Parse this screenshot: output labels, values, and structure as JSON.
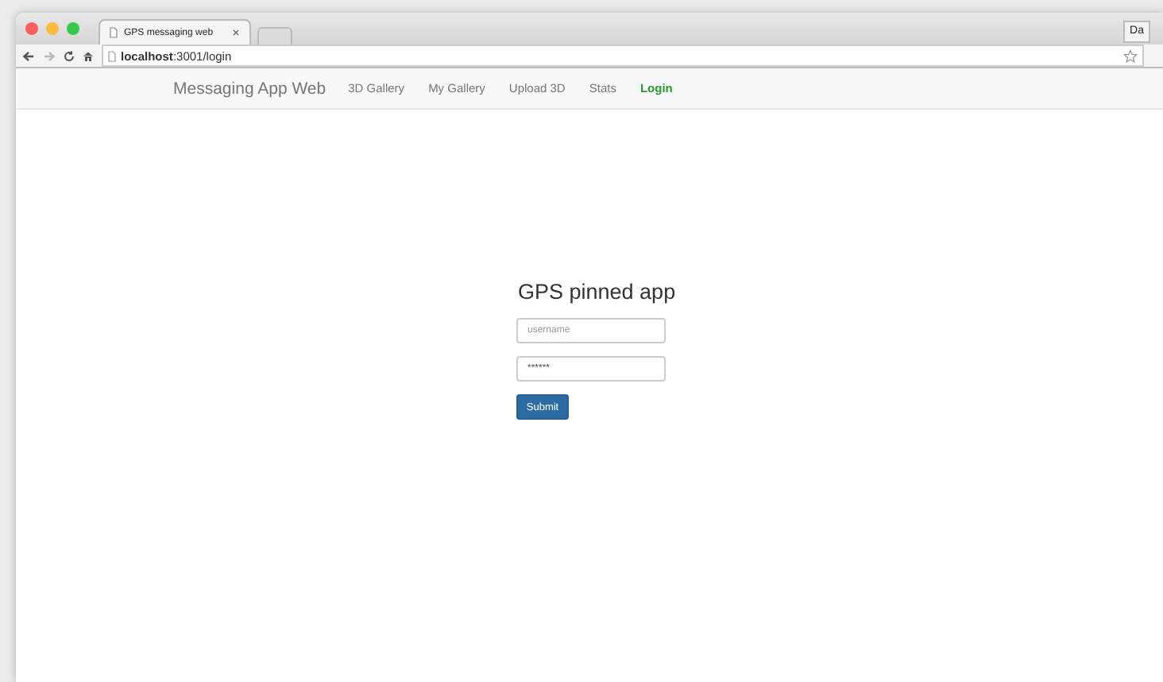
{
  "browser": {
    "tab_title": "GPS messaging web",
    "url_host": "localhost",
    "url_path": ":3001/login",
    "profile": "Da"
  },
  "navbar": {
    "brand": "Messaging App Web",
    "links": [
      {
        "label": "3D Gallery",
        "selected": false
      },
      {
        "label": "My Gallery",
        "selected": false
      },
      {
        "label": "Upload 3D",
        "selected": false
      },
      {
        "label": "Stats",
        "selected": false
      },
      {
        "label": "Login",
        "selected": true
      }
    ]
  },
  "form": {
    "title": "GPS pinned app",
    "username": {
      "placeholder": "username"
    },
    "password": {
      "value": "******"
    },
    "submit": "Submit"
  }
}
